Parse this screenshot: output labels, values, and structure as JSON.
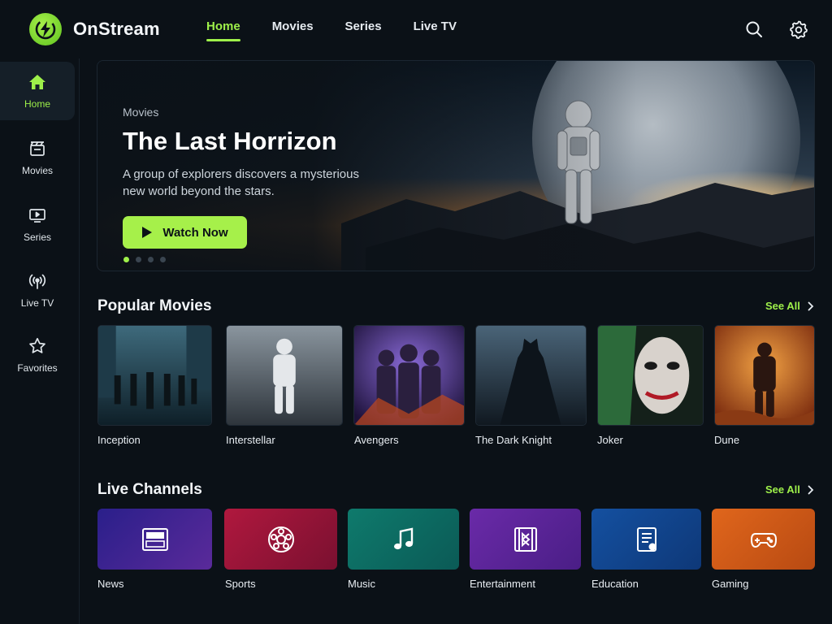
{
  "app": {
    "name": "OnStream",
    "accent": "#9ef04a"
  },
  "nav": {
    "items": [
      {
        "label": "Home",
        "active": true
      },
      {
        "label": "Movies",
        "active": false
      },
      {
        "label": "Series",
        "active": false
      },
      {
        "label": "Live TV",
        "active": false
      }
    ],
    "icons": [
      "search-icon",
      "gear-icon"
    ]
  },
  "sidebar": {
    "items": [
      {
        "label": "Home",
        "icon": "home-icon",
        "active": true
      },
      {
        "label": "Movies",
        "icon": "movies-icon",
        "active": false
      },
      {
        "label": "Series",
        "icon": "tv-icon",
        "active": false
      },
      {
        "label": "Live TV",
        "icon": "broadcast-icon",
        "active": false
      },
      {
        "label": "Favorites",
        "icon": "star-icon",
        "active": false
      }
    ]
  },
  "hero": {
    "kicker": "Movies",
    "title": "The Last Horrizon",
    "description": "A group of explorers discovers a mysterious new world beyond the stars.",
    "button": "Watch Now",
    "slides": 4,
    "active_slide": 1
  },
  "popular": {
    "title": "Popular Movies",
    "see_all": "See All",
    "movies": [
      {
        "title": "Inception",
        "color": "#2b4a5a"
      },
      {
        "title": "Interstellar",
        "color": "#6f7a84"
      },
      {
        "title": "Avengers",
        "color": "#4a2f7a"
      },
      {
        "title": "The Dark Knight",
        "color": "#2a3b4c"
      },
      {
        "title": "Joker",
        "color": "#1f3a2a"
      },
      {
        "title": "Dune",
        "color": "#d2631a"
      }
    ]
  },
  "channels": {
    "title": "Live Channels",
    "see_all": "See All",
    "items": [
      {
        "label": "News",
        "icon": "news-icon",
        "color": "#3a1f8a"
      },
      {
        "label": "Sports",
        "icon": "soccer-ball-icon",
        "color": "#a0183a"
      },
      {
        "label": "Music",
        "icon": "music-note-icon",
        "color": "#0f6e63"
      },
      {
        "label": "Entertainment",
        "icon": "film-icon",
        "color": "#5b2a9c"
      },
      {
        "label": "Education",
        "icon": "document-icon",
        "color": "#12408a"
      },
      {
        "label": "Gaming",
        "icon": "gamepad-icon",
        "color": "#d0571a"
      }
    ]
  }
}
